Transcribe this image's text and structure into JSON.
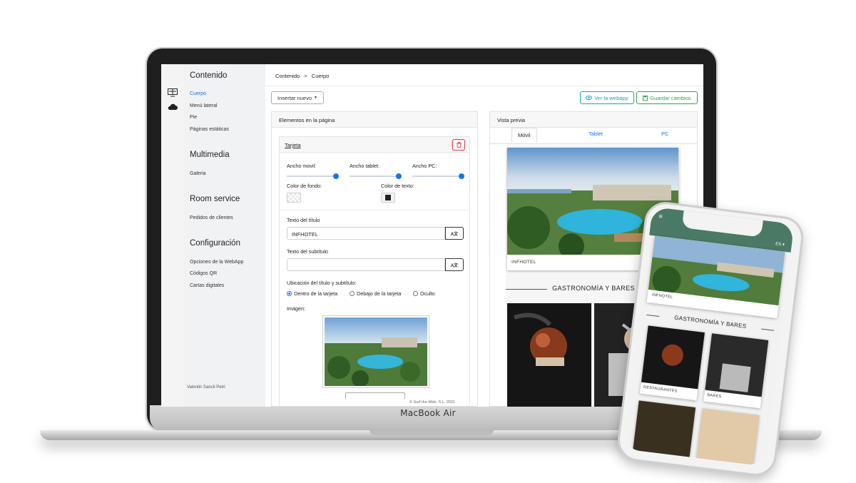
{
  "device": {
    "brand": "MacBook Air"
  },
  "sidebar": {
    "sections": [
      {
        "title": "Contenido",
        "items": [
          "Cuerpo",
          "Menú lateral",
          "Pie",
          "Páginas estáticas"
        ],
        "active_item": "Cuerpo"
      },
      {
        "title": "Multimedia",
        "items": [
          "Galeria"
        ]
      },
      {
        "title": "Room service",
        "items": [
          "Pedidos de clientes"
        ]
      },
      {
        "title": "Configuración",
        "items": [
          "Opciones de la WebApp",
          "Códigos QR",
          "Cartas digitales"
        ]
      }
    ],
    "user": "Valentin Sancti Petri"
  },
  "breadcrumb": {
    "root": "Contenido",
    "separator": ">",
    "current": "Cuerpo"
  },
  "toolbar": {
    "insert_label": "Insertar nuevo",
    "view_label": "Ver la webapp",
    "save_label": "Guardar cambios"
  },
  "elements_panel": {
    "title": "Elementos en la página",
    "card": {
      "name": "Tarjeta",
      "widths": [
        {
          "label": "Ancho movil:",
          "value_pct": 100
        },
        {
          "label": "Ancho tablet:",
          "value_pct": 100
        },
        {
          "label": "Ancho PC:",
          "value_pct": 100
        }
      ],
      "bg_color_label": "Color de fondo:",
      "text_color_label": "Color de texto:",
      "text_color": "#222222",
      "title_label": "Texto del título",
      "title_value": "INFHOTEL",
      "subtitle_label": "Texto del subtítulo",
      "subtitle_value": "",
      "translate_button": "A文",
      "position_label": "Ubicación del título y subtítulo:",
      "position_options": [
        "Dentro de la tarjeta",
        "Debajo de la tarjeta",
        "Oculto"
      ],
      "position_selected": "Dentro de la tarjeta",
      "image_label": "Imágen:"
    }
  },
  "preview_panel": {
    "title": "Vista previa",
    "tabs": [
      "Móvil",
      "Tablet",
      "PC"
    ],
    "active_tab": "Móvil",
    "card_caption": "INFHOTEL",
    "section_heading": "GASTRONOMÍA Y BARES"
  },
  "footer": "© Surf the Web, S.L. 2021",
  "phone": {
    "lang": "ES",
    "card_caption": "INFHOTEL",
    "section_heading": "GASTRONOMÍA Y BARES",
    "tiles": [
      "RESTAURANTES",
      "BARES"
    ]
  },
  "colors": {
    "accent": "#1a73e8",
    "info": "#17a2b8",
    "success": "#28a745",
    "danger": "#dc3545",
    "phone_header": "#4a7a65"
  }
}
